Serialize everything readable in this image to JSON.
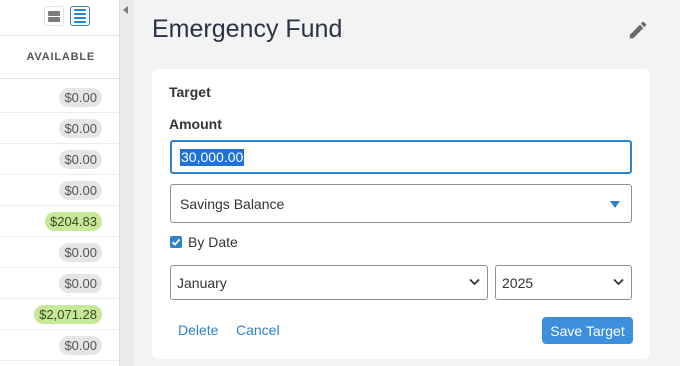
{
  "budget_column": {
    "header": "AVAILABLE",
    "rows": [
      {
        "amount": "$0.00",
        "positive": false
      },
      {
        "amount": "$0.00",
        "positive": false
      },
      {
        "amount": "$0.00",
        "positive": false
      },
      {
        "amount": "$0.00",
        "positive": false
      },
      {
        "amount": "$204.83",
        "positive": true
      },
      {
        "amount": "$0.00",
        "positive": false
      },
      {
        "amount": "$0.00",
        "positive": false
      },
      {
        "amount": "$2,071.28",
        "positive": true
      },
      {
        "amount": "$0.00",
        "positive": false
      }
    ]
  },
  "inspector": {
    "title": "Emergency Fund",
    "target": {
      "section_label": "Target",
      "amount_label": "Amount",
      "amount_value": "30,000.00",
      "target_type": "Savings Balance",
      "by_date_label": "By Date",
      "by_date_checked": true,
      "month": "January",
      "year": "2025",
      "delete_label": "Delete",
      "cancel_label": "Cancel",
      "save_label": "Save Target"
    }
  },
  "colors": {
    "accent": "#2e82c9",
    "positive_pill": "#c6e898",
    "neutral_pill": "#e5e5e5",
    "save_button": "#3c8fdc"
  },
  "icons": [
    "compact-view-icon",
    "list-view-icon",
    "collapse-caret-icon",
    "pencil-icon",
    "dropdown-triangle-icon",
    "chevron-down-icon",
    "check-icon"
  ]
}
